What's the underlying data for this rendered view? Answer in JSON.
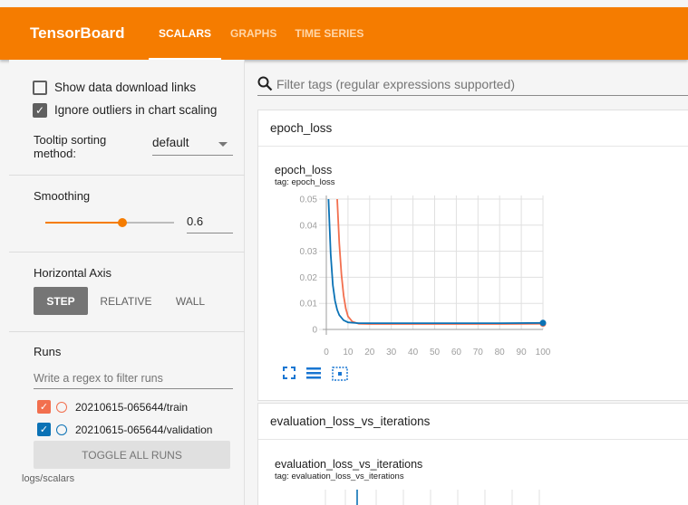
{
  "header": {
    "brand": "TensorBoard",
    "tabs": [
      {
        "label": "SCALARS",
        "active": true
      },
      {
        "label": "GRAPHS",
        "active": false
      },
      {
        "label": "TIME SERIES",
        "active": false
      }
    ],
    "accent_color": "#f57c00"
  },
  "sidebar": {
    "options": {
      "show_download_label": "Show data download links",
      "show_download_checked": false,
      "ignore_outliers_label": "Ignore outliers in chart scaling",
      "ignore_outliers_checked": true,
      "tooltip_label": "Tooltip sorting method:",
      "tooltip_value": "default"
    },
    "smoothing": {
      "title": "Smoothing",
      "value": "0.6",
      "fraction": 0.6
    },
    "horizontal_axis": {
      "title": "Horizontal Axis",
      "step": "STEP",
      "relative": "RELATIVE",
      "wall": "WALL",
      "selected": "STEP"
    },
    "runs": {
      "title": "Runs",
      "filter_placeholder": "Write a regex to filter runs",
      "items": [
        {
          "name": "20210615-065644/train",
          "color": "#f26f4e",
          "checked": true
        },
        {
          "name": "20210615-065644/validation",
          "color": "#0b72b5",
          "checked": true
        }
      ],
      "toggle_label": "TOGGLE ALL RUNS",
      "logdir": "logs/scalars"
    }
  },
  "main": {
    "filter_placeholder": "Filter tags (regular expressions supported)",
    "cards": [
      {
        "header": "epoch_loss",
        "chart_title": "epoch_loss",
        "tag": "tag: epoch_loss"
      },
      {
        "header": "evaluation_loss_vs_iterations",
        "chart_title": "evaluation_loss_vs_iterations",
        "tag": "tag: evaluation_loss_vs_iterations"
      }
    ],
    "chart_icons": [
      "fullscreen-icon",
      "lines-icon",
      "fit-domain-icon"
    ]
  },
  "chart_data": {
    "type": "line",
    "title": "epoch_loss",
    "xlabel": "",
    "ylabel": "",
    "xlim": [
      0,
      100
    ],
    "ylim": [
      0,
      0.05
    ],
    "x_ticks": [
      0,
      10,
      20,
      30,
      40,
      50,
      60,
      70,
      80,
      90,
      100
    ],
    "y_ticks": [
      "0",
      "0.01",
      "0.02",
      "0.03",
      "0.04",
      "0.05"
    ],
    "grid": true,
    "series": [
      {
        "name": "20210615-065644/train",
        "color": "#f26f4e",
        "x": [
          5,
          6,
          7,
          8,
          9,
          10,
          12,
          15,
          20,
          40,
          60,
          80,
          100
        ],
        "y": [
          0.05,
          0.033,
          0.021,
          0.013,
          0.008,
          0.005,
          0.003,
          0.0022,
          0.0021,
          0.0021,
          0.0021,
          0.0021,
          0.0022
        ]
      },
      {
        "name": "20210615-065644/validation",
        "color": "#0b72b5",
        "x": [
          1,
          2,
          3,
          4,
          5,
          6,
          8,
          10,
          15,
          20,
          40,
          60,
          80,
          100
        ],
        "y": [
          0.05,
          0.029,
          0.017,
          0.011,
          0.0075,
          0.0055,
          0.0035,
          0.0027,
          0.0024,
          0.0024,
          0.0024,
          0.0024,
          0.0024,
          0.0025
        ]
      }
    ]
  }
}
